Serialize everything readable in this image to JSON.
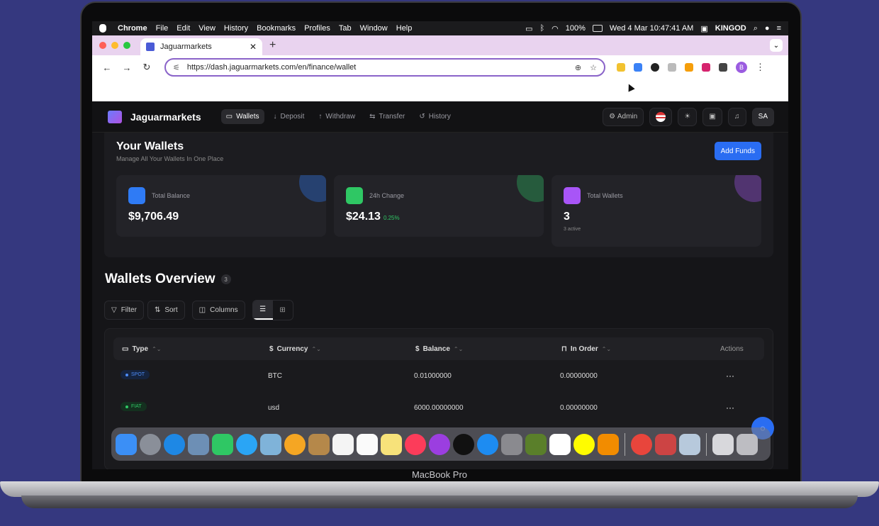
{
  "laptop_label": "MacBook Pro",
  "menubar": {
    "app": "Chrome",
    "items": [
      "File",
      "Edit",
      "View",
      "History",
      "Bookmarks",
      "Profiles",
      "Tab",
      "Window",
      "Help"
    ],
    "battery": "100%",
    "datetime": "Wed 4 Mar  10:47:41 AM",
    "user": "KINGOD"
  },
  "browser": {
    "tab_title": "Jaguarmarkets",
    "url": "https://dash.jaguarmarkets.com/en/finance/wallet",
    "profile_initial": "B"
  },
  "app": {
    "brand": "Jaguarmarkets",
    "nav": [
      {
        "label": "Wallets",
        "icon": "wallet-icon",
        "active": true
      },
      {
        "label": "Deposit",
        "icon": "download-icon"
      },
      {
        "label": "Withdraw",
        "icon": "upload-icon"
      },
      {
        "label": "Transfer",
        "icon": "transfer-icon"
      },
      {
        "label": "History",
        "icon": "history-icon"
      }
    ],
    "admin_label": "Admin",
    "avatar_initials": "SA"
  },
  "wallets": {
    "title": "Your Wallets",
    "subtitle": "Manage All Your Wallets In One Place",
    "add_funds": "Add Funds",
    "cards": [
      {
        "label": "Total Balance",
        "value": "$9,706.49",
        "color": "#2f7bf5"
      },
      {
        "label": "24h Change",
        "value": "$24.13",
        "change": "0.25%",
        "color": "#2fc764"
      },
      {
        "label": "Total Wallets",
        "value": "3",
        "sub": "3 active",
        "color": "#a855f7"
      }
    ]
  },
  "overview": {
    "title": "Wallets Overview",
    "count": "3",
    "filter": "Filter",
    "sort": "Sort",
    "columns": "Columns",
    "headers": [
      "Type",
      "Currency",
      "Balance",
      "In Order",
      "Actions"
    ],
    "rows": [
      {
        "type": "SPOT",
        "currency": "BTC",
        "balance": "0.01000000",
        "in_order": "0.00000000"
      },
      {
        "type": "FIAT",
        "currency": "usd",
        "balance": "6000.00000000",
        "in_order": "0.00000000"
      }
    ]
  }
}
